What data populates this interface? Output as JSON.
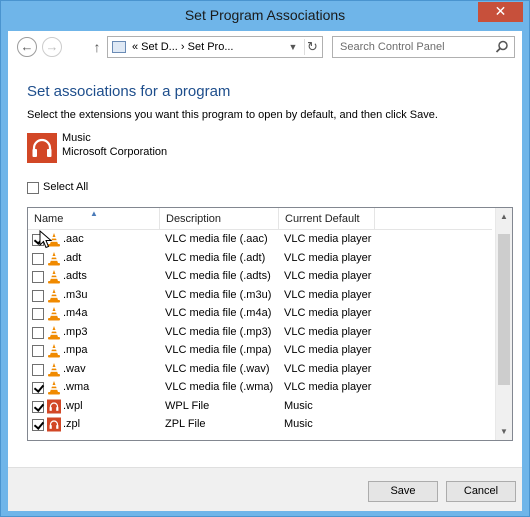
{
  "window": {
    "title": "Set Program Associations",
    "close_glyph": "✕"
  },
  "nav": {
    "back_glyph": "←",
    "forward_glyph": "→",
    "up_glyph": "↑",
    "address": "« Set D... › Set Pro...",
    "dropdown_glyph": "▼",
    "refresh_glyph": "↻",
    "search_placeholder": "Search Control Panel"
  },
  "heading": "Set associations for a program",
  "instructions": "Select the extensions you want this program to open by default, and then click Save.",
  "program": {
    "name": "Music",
    "company": "Microsoft Corporation",
    "icon": "headphones-icon",
    "color": "#d24726"
  },
  "select_all": {
    "label": "Select All",
    "checked": false
  },
  "columns": [
    "Name",
    "Description",
    "Current Default"
  ],
  "rows": [
    {
      "checked": true,
      "icon": "vlc-cone-icon",
      "name": ".aac",
      "description": "VLC media file (.aac)",
      "default": "VLC media player"
    },
    {
      "checked": false,
      "icon": "vlc-cone-icon",
      "name": ".adt",
      "description": "VLC media file (.adt)",
      "default": "VLC media player"
    },
    {
      "checked": false,
      "icon": "vlc-cone-icon",
      "name": ".adts",
      "description": "VLC media file (.adts)",
      "default": "VLC media player"
    },
    {
      "checked": false,
      "icon": "vlc-cone-icon",
      "name": ".m3u",
      "description": "VLC media file (.m3u)",
      "default": "VLC media player"
    },
    {
      "checked": false,
      "icon": "vlc-cone-icon",
      "name": ".m4a",
      "description": "VLC media file (.m4a)",
      "default": "VLC media player"
    },
    {
      "checked": false,
      "icon": "vlc-cone-icon",
      "name": ".mp3",
      "description": "VLC media file (.mp3)",
      "default": "VLC media player"
    },
    {
      "checked": false,
      "icon": "vlc-cone-icon",
      "name": ".mpa",
      "description": "VLC media file (.mpa)",
      "default": "VLC media player"
    },
    {
      "checked": false,
      "icon": "vlc-cone-icon",
      "name": ".wav",
      "description": "VLC media file (.wav)",
      "default": "VLC media player"
    },
    {
      "checked": true,
      "icon": "vlc-cone-icon",
      "name": ".wma",
      "description": "VLC media file (.wma)",
      "default": "VLC media player"
    },
    {
      "checked": true,
      "icon": "music-app-icon",
      "name": ".wpl",
      "description": "WPL File",
      "default": "Music"
    },
    {
      "checked": true,
      "icon": "music-app-icon",
      "name": ".zpl",
      "description": "ZPL File",
      "default": "Music"
    }
  ],
  "buttons": {
    "save": "Save",
    "cancel": "Cancel"
  },
  "colors": {
    "title_bar": "#6fb5e9",
    "heading": "#1e4e8c",
    "close": "#c7503b",
    "vlc_orange": "#f08a00"
  }
}
